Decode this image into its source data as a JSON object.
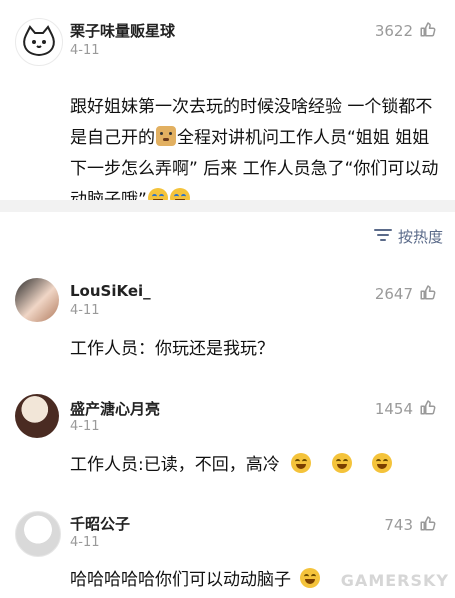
{
  "post": {
    "user": "栗子味量贩星球",
    "date": "4-11",
    "likes": "3622",
    "text_1": "跟好姐妹第一次去玩的时候没啥经验 一个锁都不是自己开的",
    "text_2": "全程对讲机问工作人员“姐姐 姐姐 下一步怎么弄啊” 后来 工作人员急了“你们可以动动脑子哦”"
  },
  "sort": {
    "label": "按热度"
  },
  "comments": [
    {
      "user": "LouSiKei_",
      "date": "4-11",
      "likes": "2647",
      "text": "工作人员：你玩还是我玩？"
    },
    {
      "user": "盛产溏心月亮",
      "date": "4-11",
      "likes": "1454",
      "text": "工作人员:已读，不回，高冷"
    },
    {
      "user": "千昭公子",
      "date": "4-11",
      "likes": "743",
      "text": "哈哈哈哈哈你们可以动动脑子"
    }
  ],
  "watermark": "GAMERSKY",
  "colors": {
    "divider": "#f2f2f2",
    "sort_text": "#5b6b8a",
    "muted": "#9a9a9a"
  },
  "icons": {
    "like": "thumb-up-icon",
    "sort": "sort-lines-icon"
  }
}
